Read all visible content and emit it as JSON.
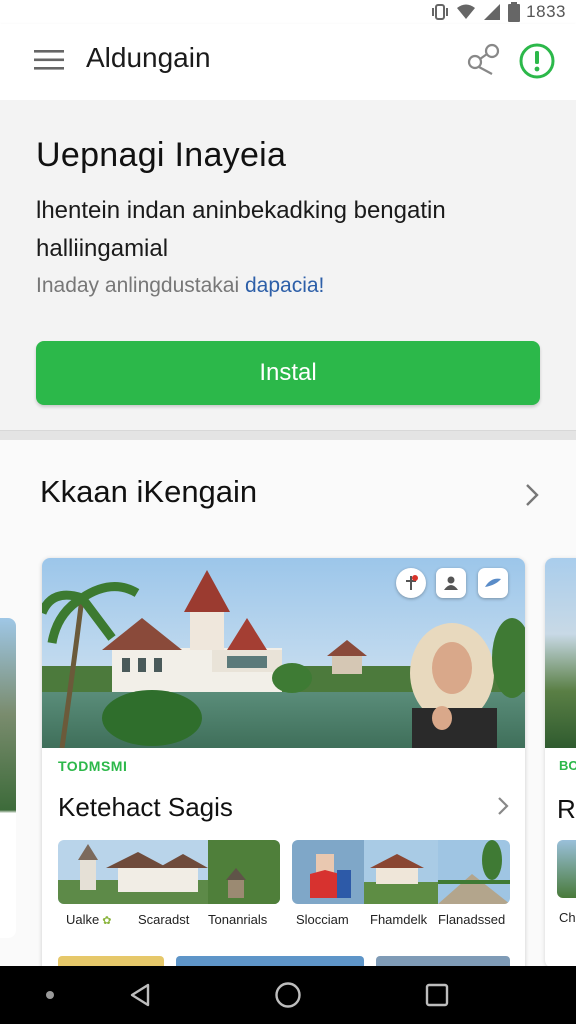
{
  "status_bar": {
    "time": "1833"
  },
  "app_bar": {
    "title": "Aldungain"
  },
  "promo": {
    "title": "Uepnagi Inayeia",
    "description": "lhentein indan aninbekadking bengatin halliingamial",
    "sub_text": "Inaday anlingdustakai",
    "sub_link": "dapacia!",
    "install_label": "Instal"
  },
  "section": {
    "title": "Kkaan iKengain",
    "card": {
      "tag": "TODMSMI",
      "title": "Ketehact Sagis",
      "thumbnails": [
        {
          "caption": "Ualke"
        },
        {
          "caption": "Scaradst"
        },
        {
          "caption": "Tonanrials"
        },
        {
          "caption": "Slocciam"
        },
        {
          "caption": "Fhamdelk"
        },
        {
          "caption": "Flanadssed"
        }
      ]
    },
    "next_card": {
      "tag": "BO",
      "title": "R",
      "caption": "Ch"
    }
  },
  "colors": {
    "accent": "#2cb84a",
    "link": "#2d5fa8",
    "nav_bar": "#000000"
  }
}
